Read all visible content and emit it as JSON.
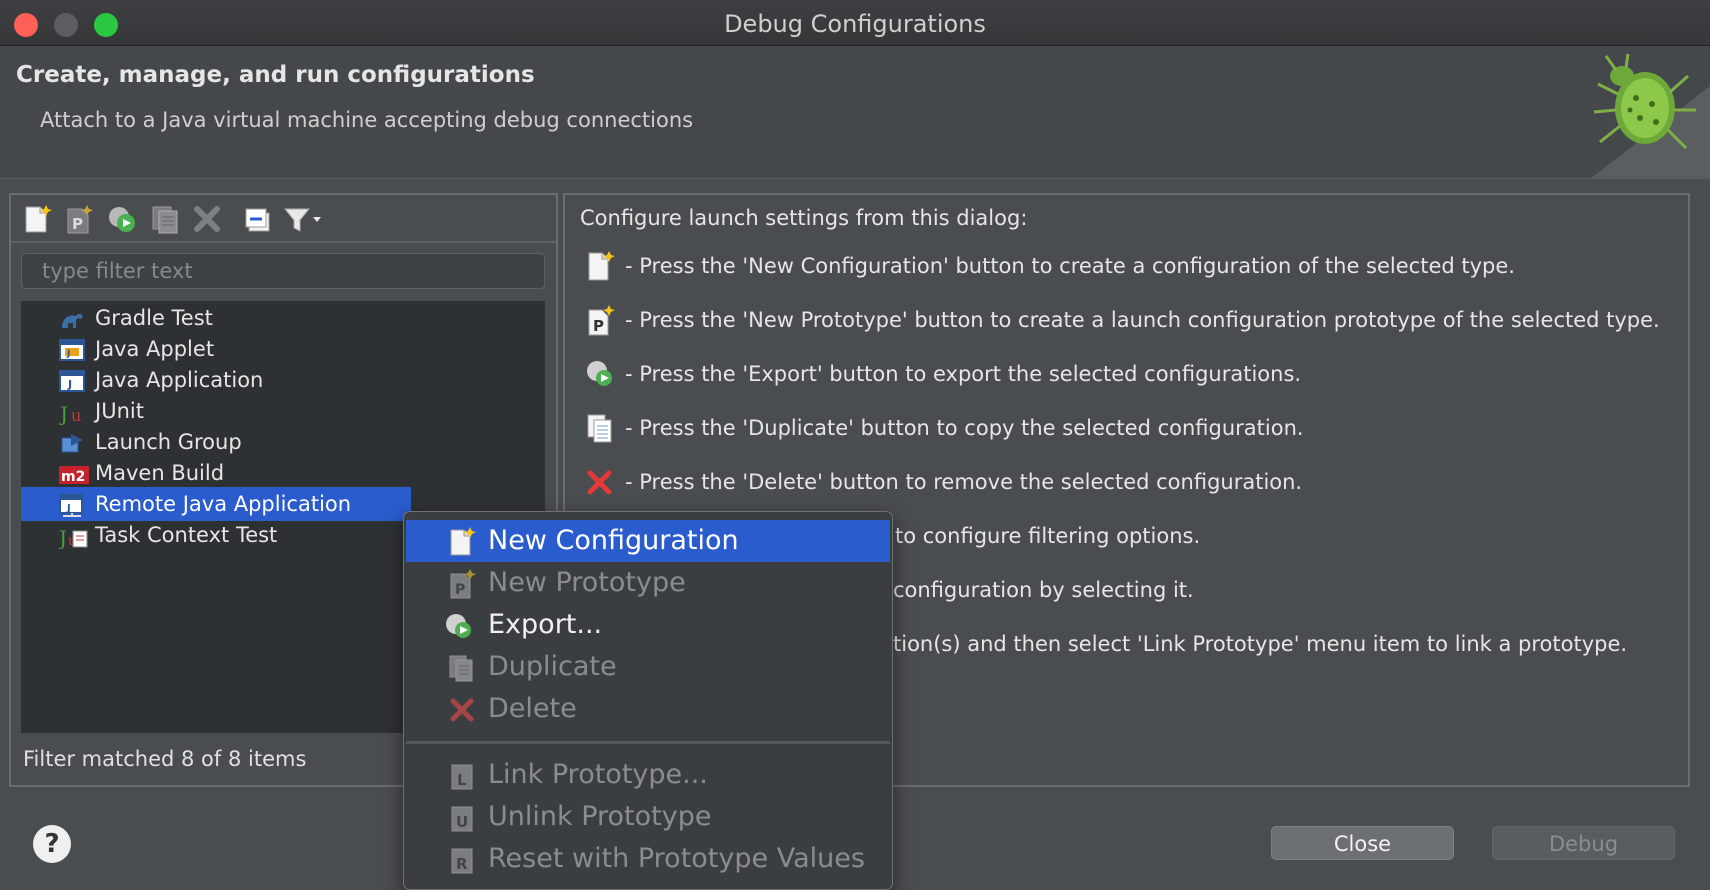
{
  "window": {
    "title": "Debug Configurations"
  },
  "banner": {
    "title": "Create, manage, and run configurations",
    "message": "Attach to a Java virtual machine accepting debug connections"
  },
  "toolbar": {
    "icons": [
      "new-configuration-icon",
      "new-prototype-icon",
      "export-icon",
      "duplicate-icon",
      "delete-icon",
      "collapse-all-icon",
      "filter-icon",
      "dropdown-arrow-icon"
    ]
  },
  "filter": {
    "placeholder": "type filter text",
    "status": "Filter matched 8 of 8 items"
  },
  "tree": {
    "items": [
      {
        "label": "Gradle Test",
        "icon": "gradle-icon"
      },
      {
        "label": "Java Applet",
        "icon": "java-applet-icon"
      },
      {
        "label": "Java Application",
        "icon": "java-application-icon"
      },
      {
        "label": "JUnit",
        "icon": "junit-icon"
      },
      {
        "label": "Launch Group",
        "icon": "launch-group-icon"
      },
      {
        "label": "Maven Build",
        "icon": "maven-icon"
      },
      {
        "label": "Remote Java Application",
        "icon": "remote-java-icon",
        "selected": true
      },
      {
        "label": "Task Context Test",
        "icon": "task-context-icon"
      }
    ]
  },
  "right_panel": {
    "heading": "Configure launch settings from this dialog:",
    "lines": [
      {
        "icon": "new-configuration-icon",
        "text": "- Press the 'New Configuration' button to create a configuration of the selected type."
      },
      {
        "icon": "new-prototype-icon",
        "text": "- Press the 'New Prototype' button to create a launch configuration prototype of the selected type."
      },
      {
        "icon": "export-icon",
        "text": "- Press the 'Export' button to export the selected configurations."
      },
      {
        "icon": "duplicate-icon",
        "text": "- Press the 'Duplicate' button to copy the selected configuration."
      },
      {
        "icon": "delete-icon",
        "text": "- Press the 'Delete' button to remove the selected configuration."
      },
      {
        "icon": "",
        "text": "to configure filtering options."
      },
      {
        "icon": "",
        "text": "configuration by selecting it."
      },
      {
        "icon": "",
        "text": "tion(s) and then select 'Link Prototype' menu item to link a prototype."
      }
    ]
  },
  "context_menu": {
    "items": [
      {
        "label": "New Configuration",
        "enabled": true,
        "highlighted": true,
        "icon": "new-configuration-icon"
      },
      {
        "label": "New Prototype",
        "enabled": false,
        "icon": "new-prototype-icon"
      },
      {
        "label": "Export...",
        "enabled": true,
        "icon": "export-icon"
      },
      {
        "label": "Duplicate",
        "enabled": false,
        "icon": "duplicate-icon"
      },
      {
        "label": "Delete",
        "enabled": false,
        "icon": "delete-icon"
      },
      {
        "label": "Link Prototype...",
        "enabled": false,
        "icon": "link-prototype-icon"
      },
      {
        "label": "Unlink Prototype",
        "enabled": false,
        "icon": "unlink-prototype-icon"
      },
      {
        "label": "Reset with Prototype Values",
        "enabled": false,
        "icon": "reset-prototype-icon"
      }
    ]
  },
  "buttons": {
    "help": "?",
    "close": "Close",
    "debug": "Debug"
  },
  "colors": {
    "selection": "#2a5cce",
    "window_bg": "#4a4d50",
    "tree_bg": "#2e3133"
  }
}
